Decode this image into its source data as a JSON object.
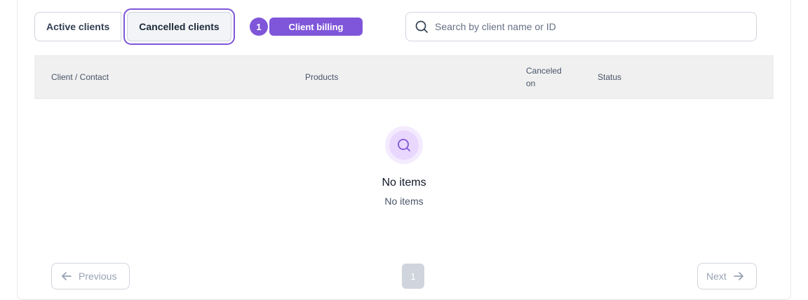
{
  "tabs": [
    {
      "label": "Active clients",
      "active": false
    },
    {
      "label": "Cancelled clients",
      "active": true
    }
  ],
  "walkthrough": {
    "step": "1",
    "label": "Client billing"
  },
  "search": {
    "placeholder": "Search by client name or ID",
    "value": ""
  },
  "table": {
    "columns": [
      "Client / Contact",
      "Products",
      "Canceled on",
      "Status"
    ],
    "rows": []
  },
  "empty_state": {
    "title": "No items",
    "subtitle": "No items",
    "icon": "search-icon"
  },
  "pagination": {
    "previous": "Previous",
    "next": "Next",
    "pages": [
      "1"
    ],
    "current": "1"
  },
  "colors": {
    "accent": "#7f56d9",
    "accent_light": "#f4ebff",
    "header_bg": "#f0f0f0",
    "page_disabled": "#d0d5dd"
  }
}
